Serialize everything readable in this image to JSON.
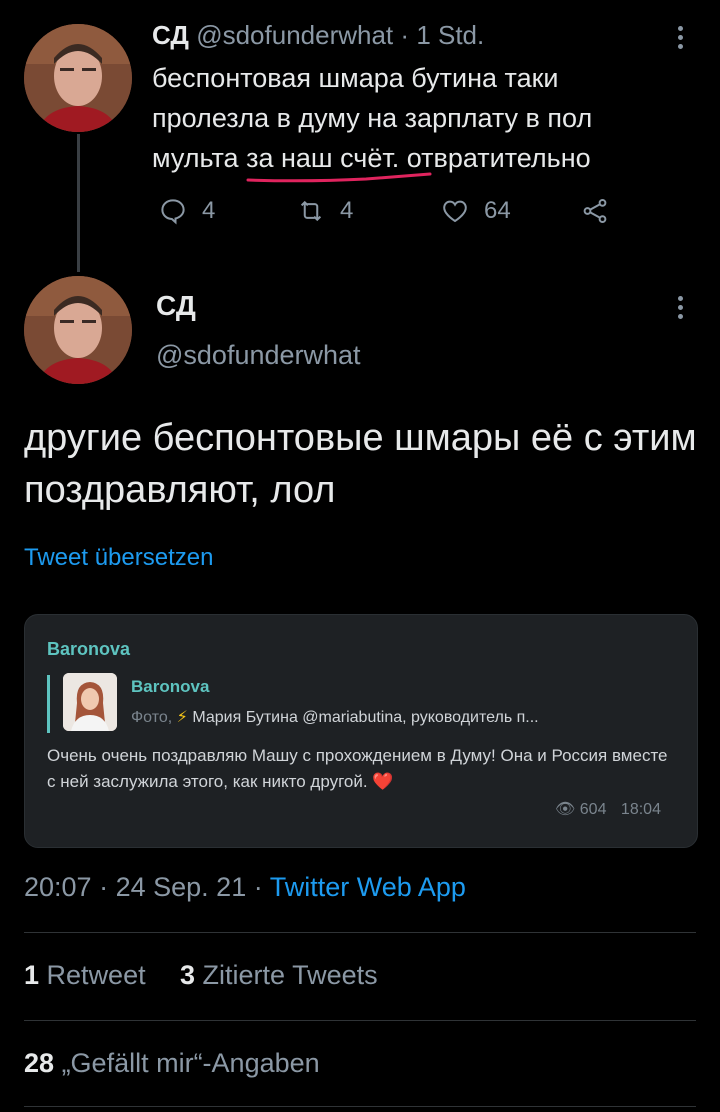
{
  "tweet1": {
    "name": "СД",
    "handle": "@sdofunderwhat",
    "sep": "·",
    "time": "1 Std.",
    "text_part1": "беспонтовая шмара бутина таки пролезла в думу на зарплату в пол мульта ",
    "text_underlined": "за наш счёт.",
    "text_part2": " отвратительно",
    "replies": "4",
    "retweets": "4",
    "likes": "64"
  },
  "tweet2": {
    "name": "СД",
    "handle": "@sdofunderwhat",
    "text": "другие беспонтовые шмары её с этим поздравляют, лол",
    "translate": "Tweet übersetzen"
  },
  "card": {
    "channel": "Baronova",
    "forward_channel": "Baronova",
    "forward_prefix": "Фото,",
    "forward_text": "Мария Бутина @mariabutina, руководитель п...",
    "message": "Очень очень поздравляю Машу с прохождением в Думу! Она и Россия вместе с ней заслужила этого, как никто другой.",
    "emoji": "❤️",
    "views": "604",
    "time": "18:04"
  },
  "meta": {
    "time": "20:07",
    "sep1": "·",
    "date": "24 Sep. 21",
    "sep2": "·",
    "source": "Twitter Web App"
  },
  "stats": {
    "retweet_count": "1",
    "retweet_label": "Retweet",
    "quote_count": "3",
    "quote_label": "Zitierte Tweets",
    "like_count": "28",
    "like_label": "„Gefällt mir“-Angaben"
  },
  "colors": {
    "accent": "#1d9bf0",
    "underline": "#e0245e",
    "telegram_name": "#5ec4c0"
  }
}
